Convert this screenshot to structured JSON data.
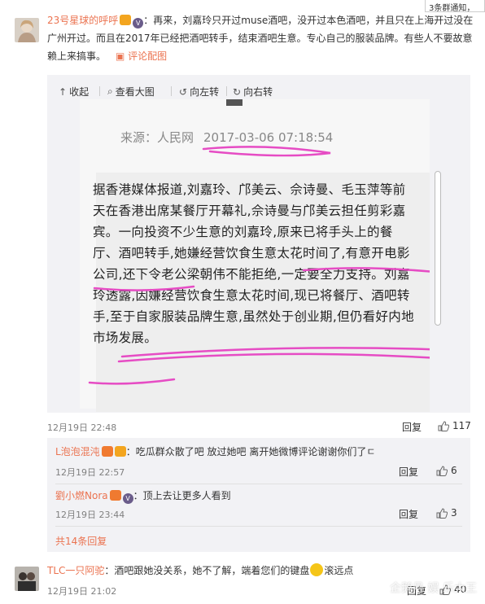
{
  "notification": "3条群通知，",
  "comment1": {
    "username": "23号星球的呼呼",
    "text": "：再来，刘嘉玲只开过muse酒吧，没开过本色酒吧，并且只在上海开过没在广州开过。而且在2017年已经把酒吧转手，结束酒吧生意。专心自己的服装品牌。有些人不要故意赖上来搞事。",
    "image_link": "评论配图",
    "toolbar": {
      "collapse": "收起",
      "view_large": "查看大图",
      "rotate_left": "向左转",
      "rotate_right": "向右转"
    },
    "source_label": "来源：人民网",
    "source_time": "2017-03-06 07:18:54",
    "article": "据香港媒体报道,刘嘉玲、邝美云、佘诗曼、毛玉萍等前天在香港出席某餐厅开幕礼,佘诗曼与邝美云担任剪彩嘉宾。一向投资不少生意的刘嘉玲,原来已将手头上的餐厅、酒吧转手,她嫌经营饮食生意太花时间了,有意开电影公司,还下令老公梁朝伟不能拒绝,一定要全力支持。刘嘉玲透露,因嫌经营饮食生意太花时间,现已将餐厅、酒吧转手,至于自家服装品牌生意,虽然处于创业期,但仍看好内地市场发展。",
    "time": "12月19日 22:48",
    "reply_label": "回复",
    "likes": "117"
  },
  "replies": [
    {
      "username": "L泡泡混沌",
      "text": "：吃瓜群众散了吧 放过她吧 离开她微博评论谢谢你们了ㄷ",
      "time": "12月19日 22:57",
      "reply_label": "回复",
      "likes": "6"
    },
    {
      "username": "劉小燃Nora",
      "text": "：顶上去让更多人看到",
      "time": "12月19日 23:44",
      "reply_label": "回复",
      "likes": "3"
    }
  ],
  "more_replies": "共14条回复",
  "comment2": {
    "username": "TLC一只阿驼",
    "text": "：酒吧跟她没关系，她不了解，端着您们的键盘",
    "text_after": "滚远点",
    "time": "12月19日 21:02",
    "reply_label": "回复",
    "likes": "40"
  },
  "watermark": "企鹅号 娱 乐大王",
  "colors": {
    "link": "#eb7350",
    "highlight": "#e64cc4",
    "panel": "#f2f2f5"
  }
}
